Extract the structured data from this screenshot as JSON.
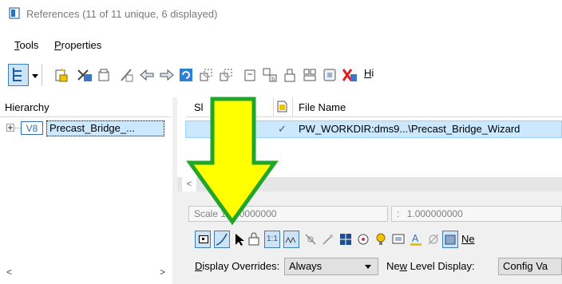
{
  "window": {
    "title": "References (11 of 11 unique, 6 displayed)"
  },
  "menu": {
    "items": [
      {
        "mnemonic": "T",
        "rest": "ools"
      },
      {
        "mnemonic": "P",
        "rest": "roperties"
      }
    ]
  },
  "toolbar": {
    "overflow_label_mnemonic": "H",
    "overflow_label_rest": "i"
  },
  "hierarchy": {
    "header": "Hierarchy",
    "tree_badge": "V8",
    "tree_item": "Precast_Bridge_..."
  },
  "reference_list": {
    "columns": {
      "slot": "Sl",
      "file_name": "File Name"
    },
    "rows": [
      {
        "check": "✓",
        "file_name": "PW_WORKDIR:dms9...\\Precast_Bridge_Wizard"
      }
    ]
  },
  "properties": {
    "scale_label": "Scale",
    "scale_value": ".000000000",
    "scale_sep": ":",
    "scale_value2": "1.000000000",
    "scale_hidden": "1",
    "button_1_1": "1:1",
    "new_label_partial": "Ne",
    "display_overrides_label": "Display Overrides:",
    "display_overrides_value": "Always",
    "new_level_display_label": "New Level Display:",
    "new_level_display_value": "Config Va"
  },
  "annotation": {
    "arrow_fill": "#ffff00",
    "arrow_stroke": "#22a62a"
  }
}
